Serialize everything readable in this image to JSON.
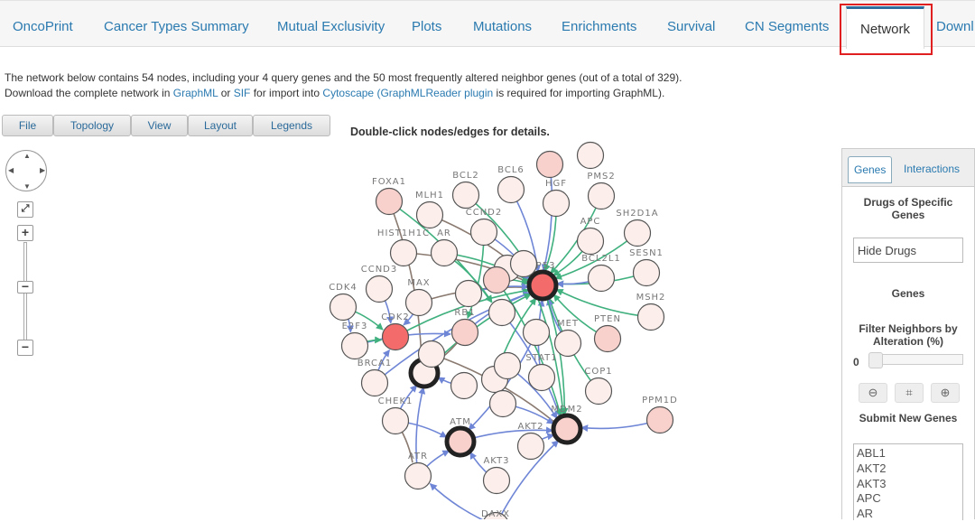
{
  "tabs": [
    {
      "label": "OncoPrint"
    },
    {
      "label": "Cancer Types Summary"
    },
    {
      "label": "Mutual Exclusivity"
    },
    {
      "label": "Plots"
    },
    {
      "label": "Mutations"
    },
    {
      "label": "Enrichments"
    },
    {
      "label": "Survival"
    },
    {
      "label": "CN Segments"
    },
    {
      "label": "Network",
      "active": true
    },
    {
      "label": "Downl"
    }
  ],
  "intro": {
    "line1": "The network below contains 54 nodes, including your 4 query genes and the 50 most frequently altered neighbor genes (out of a total of 329).",
    "line2_a": "Download the complete network in ",
    "graphml": "GraphML",
    "or": " or ",
    "sif": "SIF",
    "line2_b": " for import into ",
    "cytoscape": "Cytoscape",
    "paren_open": " (",
    "plugin": "GraphMLReader plugin",
    "line2_c": " is required for importing GraphML)."
  },
  "toolbar": [
    "File",
    "Topology",
    "View",
    "Layout",
    "Legends"
  ],
  "hint": "Double-click nodes/edges for details.",
  "colors": {
    "link": "#2a7ab0",
    "node_low": "#fbeeeb",
    "node_mid": "#f8d0cc",
    "node_high": "#f46b6b",
    "edge_blue": "#6f86d6",
    "edge_green": "#3fb07e",
    "edge_brown": "#8a7a70",
    "highlight": "#e02020"
  },
  "network": {
    "nodes": [
      {
        "label": "FOXA1",
        "level": "mid"
      },
      {
        "label": "MLH1",
        "level": "low"
      },
      {
        "label": "BCL2",
        "level": "low"
      },
      {
        "label": "BCL6",
        "level": "low"
      },
      {
        "label": "",
        "level": "mid"
      },
      {
        "label": "",
        "level": "low"
      },
      {
        "label": "HGF",
        "level": "low"
      },
      {
        "label": "PMS2",
        "level": "low"
      },
      {
        "label": "SH2D1A",
        "level": "low"
      },
      {
        "label": "APC",
        "level": "low"
      },
      {
        "label": "SESN1",
        "level": "low"
      },
      {
        "label": "BCL2L1",
        "level": "low"
      },
      {
        "label": "MSH2",
        "level": "low"
      },
      {
        "label": "PTEN",
        "level": "mid"
      },
      {
        "label": "CDK4",
        "level": "low"
      },
      {
        "label": "CCND3",
        "level": "low"
      },
      {
        "label": "HIST1H1C",
        "level": "low"
      },
      {
        "label": "AR",
        "level": "low"
      },
      {
        "label": "CCND2",
        "level": "low"
      },
      {
        "label": "MAX",
        "level": "low"
      },
      {
        "label": "E2F3",
        "level": "low"
      },
      {
        "label": "CDK2",
        "level": "high"
      },
      {
        "label": "TP53",
        "level": "high",
        "query": true
      },
      {
        "label": "RB1",
        "level": "mid"
      },
      {
        "label": "BRCA1",
        "level": "low"
      },
      {
        "label": "",
        "level": "low",
        "query": true
      },
      {
        "label": "CHEK1",
        "level": "low"
      },
      {
        "label": "ATM",
        "level": "mid",
        "query": true
      },
      {
        "label": "ATR",
        "level": "low"
      },
      {
        "label": "AKT3",
        "level": "low"
      },
      {
        "label": "AKT2",
        "level": "low"
      },
      {
        "label": "MDM2",
        "level": "mid",
        "query": true
      },
      {
        "label": "PPM1D",
        "level": "mid"
      },
      {
        "label": "COP1",
        "level": "low"
      },
      {
        "label": "MET",
        "level": "low"
      },
      {
        "label": "STAT1",
        "level": "low"
      },
      {
        "label": "",
        "level": "low"
      },
      {
        "label": "",
        "level": "low"
      },
      {
        "label": "",
        "level": "mid"
      },
      {
        "label": "",
        "level": "low"
      },
      {
        "label": "",
        "level": "low"
      },
      {
        "label": "",
        "level": "low"
      },
      {
        "label": "",
        "level": "low"
      },
      {
        "label": "",
        "level": "low"
      },
      {
        "label": "",
        "level": "low"
      },
      {
        "label": "",
        "level": "low"
      },
      {
        "label": "",
        "level": "low"
      },
      {
        "label": "DAXX",
        "level": "low"
      }
    ],
    "edges": [
      [
        0,
        25,
        "brown"
      ],
      [
        0,
        36,
        "green"
      ],
      [
        1,
        22,
        "brown"
      ],
      [
        2,
        22,
        "green"
      ],
      [
        3,
        22,
        "blue"
      ],
      [
        4,
        22,
        "blue"
      ],
      [
        6,
        22,
        "green"
      ],
      [
        7,
        22,
        "green"
      ],
      [
        8,
        22,
        "green"
      ],
      [
        9,
        22,
        "green"
      ],
      [
        10,
        22,
        "green"
      ],
      [
        11,
        22,
        "blue"
      ],
      [
        12,
        22,
        "green"
      ],
      [
        13,
        22,
        "green"
      ],
      [
        14,
        21,
        "green"
      ],
      [
        15,
        21,
        "blue"
      ],
      [
        16,
        22,
        "brown"
      ],
      [
        17,
        22,
        "green"
      ],
      [
        18,
        22,
        "blue"
      ],
      [
        19,
        22,
        "brown"
      ],
      [
        20,
        23,
        "blue"
      ],
      [
        21,
        22,
        "green"
      ],
      [
        23,
        22,
        "blue"
      ],
      [
        24,
        22,
        "blue"
      ],
      [
        25,
        22,
        "green"
      ],
      [
        26,
        25,
        "blue"
      ],
      [
        26,
        27,
        "blue"
      ],
      [
        28,
        27,
        "blue"
      ],
      [
        28,
        25,
        "blue"
      ],
      [
        29,
        27,
        "blue"
      ],
      [
        30,
        31,
        "blue"
      ],
      [
        27,
        31,
        "blue"
      ],
      [
        32,
        31,
        "blue"
      ],
      [
        33,
        22,
        "green"
      ],
      [
        34,
        22,
        "blue"
      ],
      [
        35,
        22,
        "blue"
      ],
      [
        22,
        31,
        "green"
      ],
      [
        36,
        31,
        "blue"
      ],
      [
        37,
        22,
        "blue"
      ],
      [
        38,
        22,
        "green"
      ],
      [
        39,
        31,
        "green"
      ],
      [
        40,
        22,
        "blue"
      ],
      [
        41,
        31,
        "brown"
      ],
      [
        42,
        25,
        "blue"
      ],
      [
        43,
        22,
        "green"
      ],
      [
        44,
        31,
        "blue"
      ],
      [
        45,
        27,
        "blue"
      ],
      [
        46,
        31,
        "blue"
      ],
      [
        47,
        31,
        "blue"
      ],
      [
        47,
        28,
        "blue"
      ],
      [
        24,
        21,
        "blue"
      ],
      [
        20,
        21,
        "green"
      ],
      [
        23,
        25,
        "brown"
      ],
      [
        19,
        21,
        "blue"
      ],
      [
        14,
        20,
        "blue"
      ],
      [
        26,
        28,
        "brown"
      ],
      [
        18,
        23,
        "green"
      ],
      [
        17,
        36,
        "green"
      ],
      [
        38,
        31,
        "green"
      ]
    ]
  },
  "panel": {
    "tabs": [
      "Genes",
      "Interactions"
    ],
    "drugs_heading": "Drugs of Specific Genes",
    "drugs_select": "Hide Drugs",
    "genes_heading": "Genes",
    "filter_heading": "Filter Neighbors by Alteration (%)",
    "slider_value": "0",
    "slider_level": 0,
    "submit_heading": "Submit New Genes",
    "gene_list": [
      "ABL1",
      "AKT2",
      "AKT3",
      "APC",
      "AR"
    ]
  }
}
